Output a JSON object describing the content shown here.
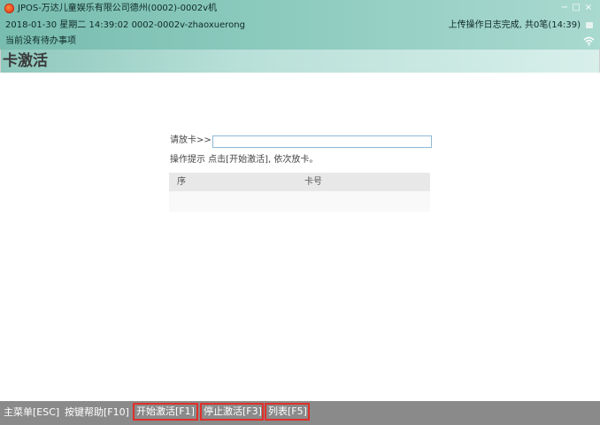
{
  "window": {
    "title": "JPOS-万达儿童娱乐有限公司德州(0002)-0002v机",
    "controls": {
      "minimize": "−",
      "maximize": "□",
      "close": "×"
    }
  },
  "info": {
    "datetime_user": "2018-01-30 星期二 14:39:02 0002-0002v-zhaoxuerong",
    "todo": "当前没有待办事项",
    "upload_status": "上传操作日志完成, 共0笔(14:39)"
  },
  "page": {
    "title": "卡激活"
  },
  "form": {
    "prompt_label": "请放卡>>",
    "card_input_value": "",
    "hint": "操作提示  点击[开始激活], 依次放卡。"
  },
  "table": {
    "columns": [
      "序",
      "卡号"
    ],
    "rows": []
  },
  "bottom_bar": {
    "menu": "主菜单[ESC]",
    "help": "按键帮助[F10]",
    "start": "开始激活[F1]",
    "stop": "停止激活[F3]",
    "list": "列表[F5]"
  },
  "colors": {
    "header_accent": "#8ccabe",
    "bottom_bar": "#8a8a8a",
    "highlight_border": "#e0302a"
  }
}
